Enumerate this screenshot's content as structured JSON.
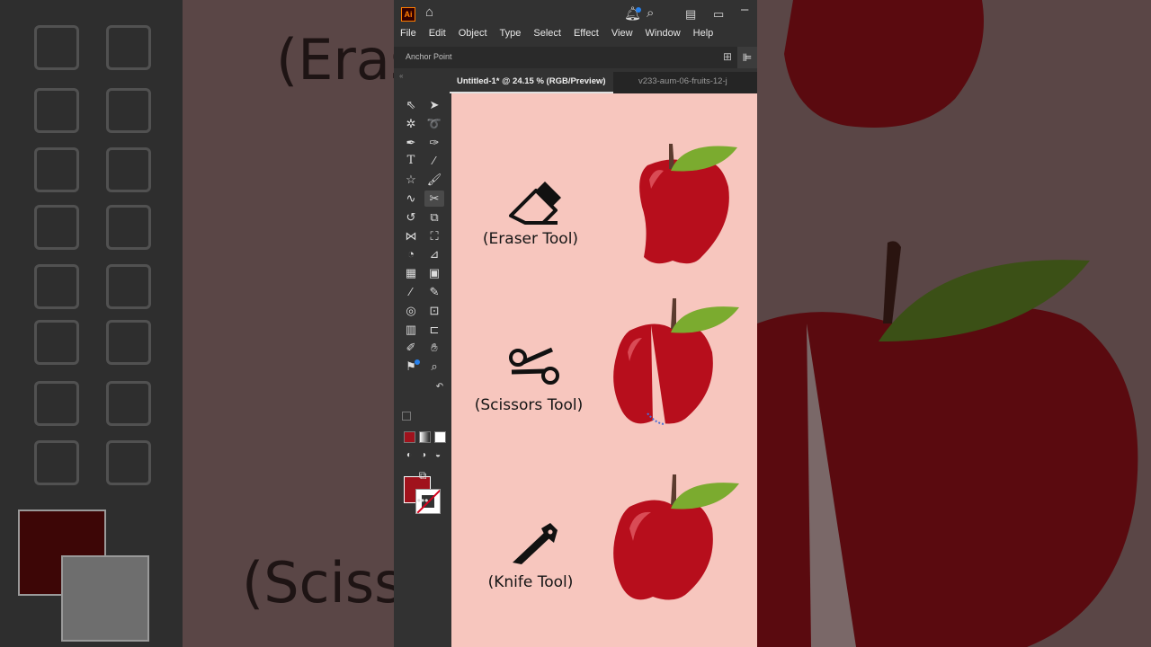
{
  "app": {
    "logo": "Ai",
    "menu": [
      "File",
      "Edit",
      "Object",
      "Type",
      "Select",
      "Effect",
      "View",
      "Window",
      "Help"
    ],
    "control_bar_label": "Anchor Point",
    "tabs": [
      {
        "label": "Untitled-1* @ 24.15 % (RGB/Preview)",
        "active": true
      },
      {
        "label": "v233-aum-06-fruits-12-j",
        "active": false
      }
    ],
    "fill_color": "#a0121c",
    "accent_color": "#2680eb"
  },
  "artboard": {
    "background": "#f7c6be",
    "tools": [
      {
        "caption": "(Eraser Tool)",
        "icon": "eraser-icon"
      },
      {
        "caption": "(Scissors Tool)",
        "icon": "scissors-icon"
      },
      {
        "caption": "(Knife Tool)",
        "icon": "knife-icon"
      }
    ],
    "apple_colors": {
      "body": "#b70e1c",
      "leaf": "#7bab2f",
      "stem": "#5c3b2e"
    }
  },
  "background": {
    "left_text_1": "(Eras",
    "left_text_2": "(Scisso"
  }
}
